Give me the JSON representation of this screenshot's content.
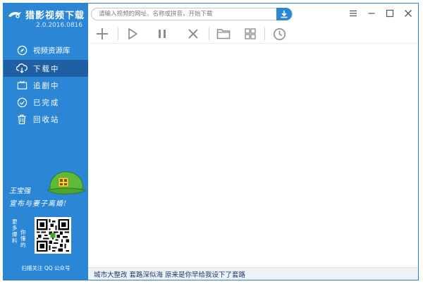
{
  "app": {
    "title": "猎影视频下载",
    "version": "2.0.2016.0816"
  },
  "sidebar": {
    "resource_label": "视频资源库",
    "items": [
      {
        "label": "下载中",
        "icon": "cloud-download-icon",
        "active": true
      },
      {
        "label": "追剧中",
        "icon": "tv-icon",
        "active": false
      },
      {
        "label": "已完成",
        "icon": "check-circle-icon",
        "active": false
      },
      {
        "label": "回收站",
        "icon": "trash-icon",
        "active": false
      }
    ],
    "promo": {
      "line1": "王宝强",
      "line2": "宣布与妻子离婚!",
      "side1": "更多爆料",
      "side2": "你懂的",
      "caption": "扫描关注 QQ 公众号"
    }
  },
  "search": {
    "placeholder": "请输入视频的网址、名称或拼音，开始下载"
  },
  "toolbar": {
    "buttons": [
      "add-icon",
      "play-icon",
      "pause-icon",
      "delete-icon",
      "folder-icon",
      "grid-view-icon",
      "clock-icon"
    ]
  },
  "statusbar": {
    "text": "城市大整改 套路深似海 原来是你早给我设下了套路"
  },
  "colors": {
    "sidebar": "#2b86d6",
    "sidebar_active": "#1f5fa3",
    "accent": "#2b86d6"
  }
}
